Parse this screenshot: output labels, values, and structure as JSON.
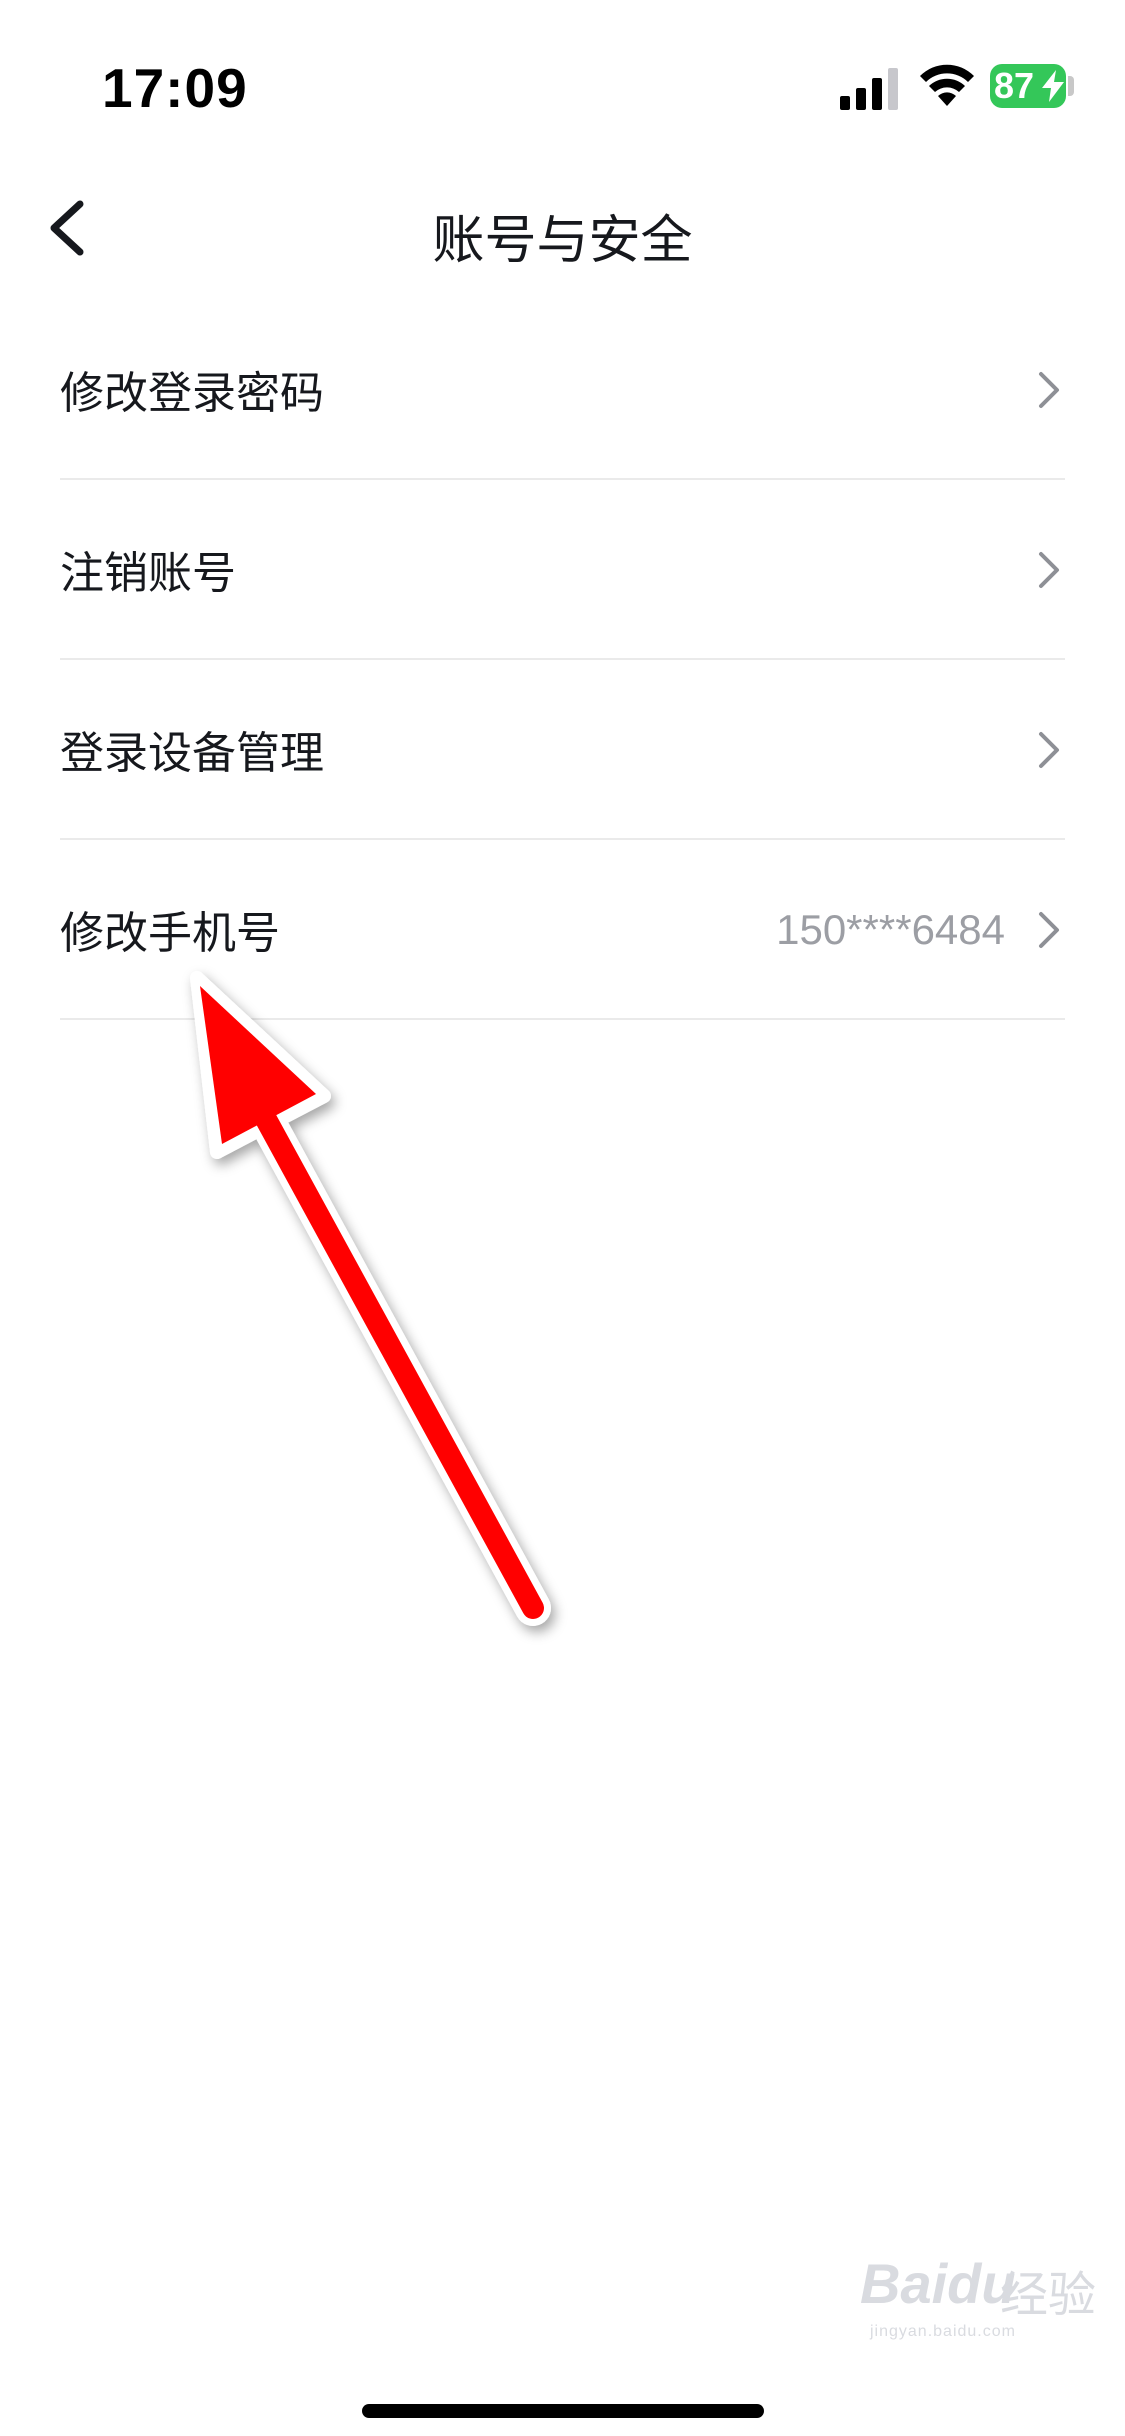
{
  "status_bar": {
    "time": "17:09",
    "battery_percent": "87",
    "battery_color": "#34c759"
  },
  "nav": {
    "title": "账号与安全",
    "back_icon": "chevron-left-icon"
  },
  "menu": {
    "items": [
      {
        "label": "修改登录密码",
        "value": ""
      },
      {
        "label": "注销账号",
        "value": ""
      },
      {
        "label": "登录设备管理",
        "value": ""
      },
      {
        "label": "修改手机号",
        "value": "150****6484"
      }
    ],
    "chevron_icon": "chevron-right-icon"
  },
  "annotation": {
    "type": "arrow",
    "color": "#ff0000",
    "points_to": "修改手机号"
  },
  "watermark": {
    "brand": "Baidu",
    "cn": "经验",
    "url": "jingyan.baidu.com"
  }
}
